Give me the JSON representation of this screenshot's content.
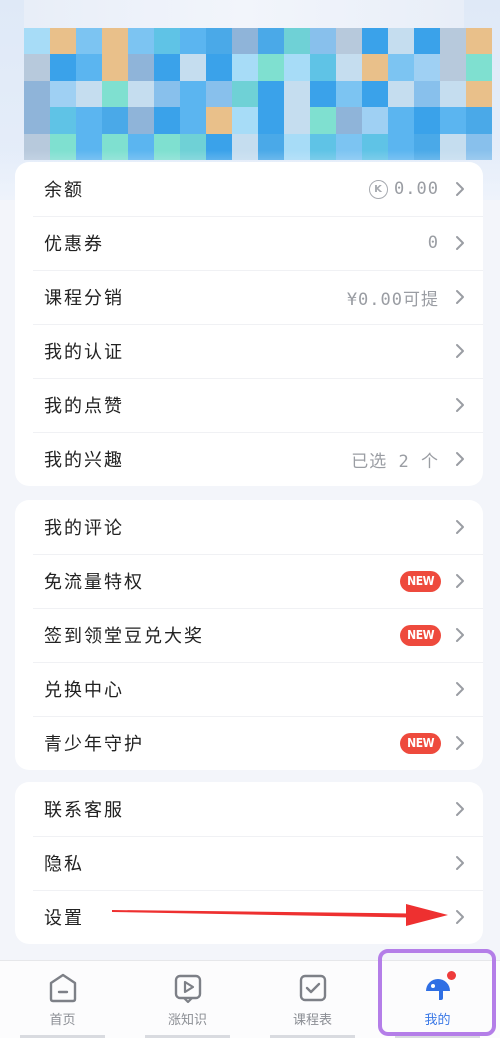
{
  "account": {
    "rows": [
      {
        "label": "余额",
        "value": "0.00",
        "coin": true
      },
      {
        "label": "优惠券",
        "value": "0"
      },
      {
        "label": "课程分销",
        "value": "¥0.00可提"
      },
      {
        "label": "我的认证",
        "value": ""
      },
      {
        "label": "我的点赞",
        "value": ""
      },
      {
        "label": "我的兴趣",
        "value": "已选 2 个"
      }
    ]
  },
  "features": {
    "rows": [
      {
        "label": "我的评论",
        "badge": ""
      },
      {
        "label": "免流量特权",
        "badge": "NEW"
      },
      {
        "label": "签到领堂豆兑大奖",
        "badge": "NEW"
      },
      {
        "label": "兑换中心",
        "badge": ""
      },
      {
        "label": "青少年守护",
        "badge": "NEW"
      }
    ]
  },
  "support": {
    "rows": [
      {
        "label": "联系客服"
      },
      {
        "label": "隐私"
      },
      {
        "label": "设置"
      }
    ]
  },
  "tabbar": {
    "tabs": [
      {
        "label": "首页",
        "icon": "home-icon"
      },
      {
        "label": "涨知识",
        "icon": "play-icon"
      },
      {
        "label": "课程表",
        "icon": "checkbox-icon"
      },
      {
        "label": "我的",
        "icon": "profile-icon"
      }
    ]
  },
  "colors": {
    "accent": "#3a78e6",
    "badge": "#ee4a3d",
    "highlight": "#b47ee8"
  }
}
